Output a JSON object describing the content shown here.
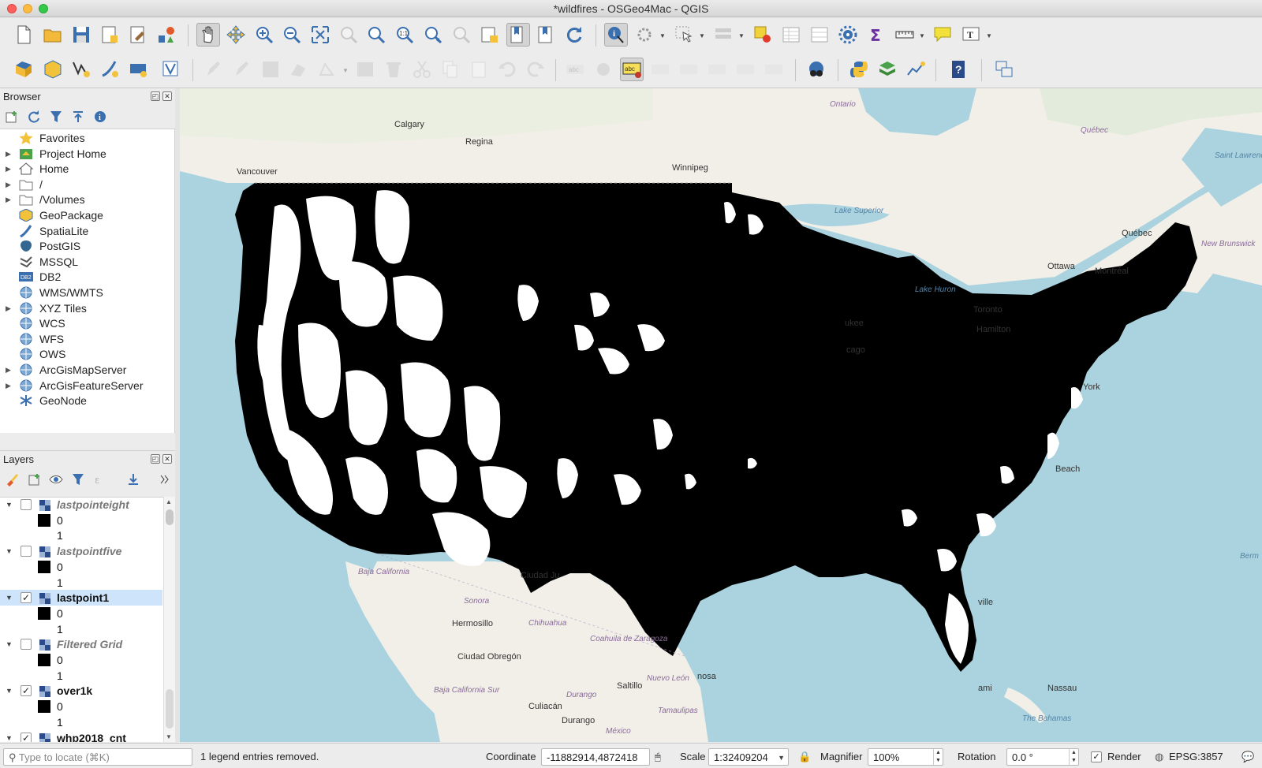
{
  "window": {
    "title": "*wildfires - OSGeo4Mac - QGIS"
  },
  "browser": {
    "title": "Browser",
    "items": [
      {
        "label": "Favorites",
        "icon": "star-icon",
        "expandable": false
      },
      {
        "label": "Project Home",
        "icon": "project-home-icon",
        "expandable": true
      },
      {
        "label": "Home",
        "icon": "home-icon",
        "expandable": true
      },
      {
        "label": "/",
        "icon": "folder-icon",
        "expandable": true
      },
      {
        "label": "/Volumes",
        "icon": "folder-icon",
        "expandable": true
      },
      {
        "label": "GeoPackage",
        "icon": "geopackage-icon",
        "expandable": false
      },
      {
        "label": "SpatiaLite",
        "icon": "spatialite-icon",
        "expandable": false
      },
      {
        "label": "PostGIS",
        "icon": "postgis-icon",
        "expandable": false
      },
      {
        "label": "MSSQL",
        "icon": "mssql-icon",
        "expandable": false
      },
      {
        "label": "DB2",
        "icon": "db2-icon",
        "expandable": false
      },
      {
        "label": "WMS/WMTS",
        "icon": "globe-icon",
        "expandable": false
      },
      {
        "label": "XYZ Tiles",
        "icon": "globe-icon",
        "expandable": true
      },
      {
        "label": "WCS",
        "icon": "globe-icon",
        "expandable": false
      },
      {
        "label": "WFS",
        "icon": "globe-icon",
        "expandable": false
      },
      {
        "label": "OWS",
        "icon": "globe-icon",
        "expandable": false
      },
      {
        "label": "ArcGisMapServer",
        "icon": "globe-icon",
        "expandable": true
      },
      {
        "label": "ArcGisFeatureServer",
        "icon": "globe-icon",
        "expandable": true
      },
      {
        "label": "GeoNode",
        "icon": "geonode-icon",
        "expandable": false
      }
    ]
  },
  "layers": {
    "title": "Layers",
    "items": [
      {
        "type": "layer",
        "name": "lastpointeight",
        "checked": false,
        "selected": false
      },
      {
        "type": "legend",
        "value": "0",
        "swatch": true
      },
      {
        "type": "legend",
        "value": "1",
        "swatch": false
      },
      {
        "type": "layer",
        "name": "lastpointfive",
        "checked": false,
        "selected": false
      },
      {
        "type": "legend",
        "value": "0",
        "swatch": true
      },
      {
        "type": "legend",
        "value": "1",
        "swatch": false
      },
      {
        "type": "layer",
        "name": "lastpoint1",
        "checked": true,
        "selected": true
      },
      {
        "type": "legend",
        "value": "0",
        "swatch": true
      },
      {
        "type": "legend",
        "value": "1",
        "swatch": false
      },
      {
        "type": "layer",
        "name": "Filtered Grid",
        "checked": false,
        "selected": false
      },
      {
        "type": "legend",
        "value": "0",
        "swatch": true
      },
      {
        "type": "legend",
        "value": "1",
        "swatch": false
      },
      {
        "type": "layer",
        "name": "over1k",
        "checked": true,
        "selected": false
      },
      {
        "type": "legend",
        "value": "0",
        "swatch": true
      },
      {
        "type": "legend",
        "value": "1",
        "swatch": false
      },
      {
        "type": "layer",
        "name": "whp2018_cnt",
        "checked": true,
        "selected": false
      }
    ]
  },
  "map": {
    "labels": [
      {
        "text": "Calgary",
        "kind": "city"
      },
      {
        "text": "Regina",
        "kind": "city"
      },
      {
        "text": "Winnipeg",
        "kind": "city"
      },
      {
        "text": "Vancouver",
        "kind": "city"
      },
      {
        "text": "Ontario",
        "kind": "region"
      },
      {
        "text": "Québec",
        "kind": "region"
      },
      {
        "text": "Québec",
        "kind": "city"
      },
      {
        "text": "Ottawa",
        "kind": "city"
      },
      {
        "text": "Montréal",
        "kind": "city"
      },
      {
        "text": "Toronto",
        "kind": "city"
      },
      {
        "text": "Hamilton",
        "kind": "city"
      },
      {
        "text": "Lake Superior",
        "kind": "water"
      },
      {
        "text": "Lake Huron",
        "kind": "water"
      },
      {
        "text": "New Brunswick",
        "kind": "region"
      },
      {
        "text": "Saint Lawrence River",
        "kind": "water"
      },
      {
        "text": "ukee",
        "kind": "city"
      },
      {
        "text": "cago",
        "kind": "city"
      },
      {
        "text": "York",
        "kind": "city"
      },
      {
        "text": "Beach",
        "kind": "city"
      },
      {
        "text": "ville",
        "kind": "city"
      },
      {
        "text": "ami",
        "kind": "city"
      },
      {
        "text": "Nassau",
        "kind": "city"
      },
      {
        "text": "The Bahamas",
        "kind": "water"
      },
      {
        "text": "Berm",
        "kind": "water"
      },
      {
        "text": "Baja California",
        "kind": "region"
      },
      {
        "text": "Ciudad Ju",
        "kind": "city"
      },
      {
        "text": "Sonora",
        "kind": "region"
      },
      {
        "text": "Hermosillo",
        "kind": "city"
      },
      {
        "text": "Chihuahua",
        "kind": "region"
      },
      {
        "text": "Coahuila de Zaragoza",
        "kind": "region"
      },
      {
        "text": "Ciudad Obregón",
        "kind": "city"
      },
      {
        "text": "Nuevo León",
        "kind": "region"
      },
      {
        "text": "Saltillo",
        "kind": "city"
      },
      {
        "text": "Baja California Sur",
        "kind": "region"
      },
      {
        "text": "Durango",
        "kind": "region"
      },
      {
        "text": "Culiacán",
        "kind": "city"
      },
      {
        "text": "Durango",
        "kind": "city"
      },
      {
        "text": "Tamaulipas",
        "kind": "region"
      },
      {
        "text": "México",
        "kind": "region"
      },
      {
        "text": "nosa",
        "kind": "city"
      }
    ]
  },
  "status": {
    "locate_placeholder": "Type to locate (⌘K)",
    "message": "1 legend entries removed.",
    "coordinate_label": "Coordinate",
    "coordinate_value": "-11882914,4872418",
    "scale_label": "Scale",
    "scale_value": "1:32409204",
    "magnifier_label": "Magnifier",
    "magnifier_value": "100%",
    "rotation_label": "Rotation",
    "rotation_value": "0.0 °",
    "render_label": "Render",
    "render_checked": true,
    "crs": "EPSG:3857"
  }
}
